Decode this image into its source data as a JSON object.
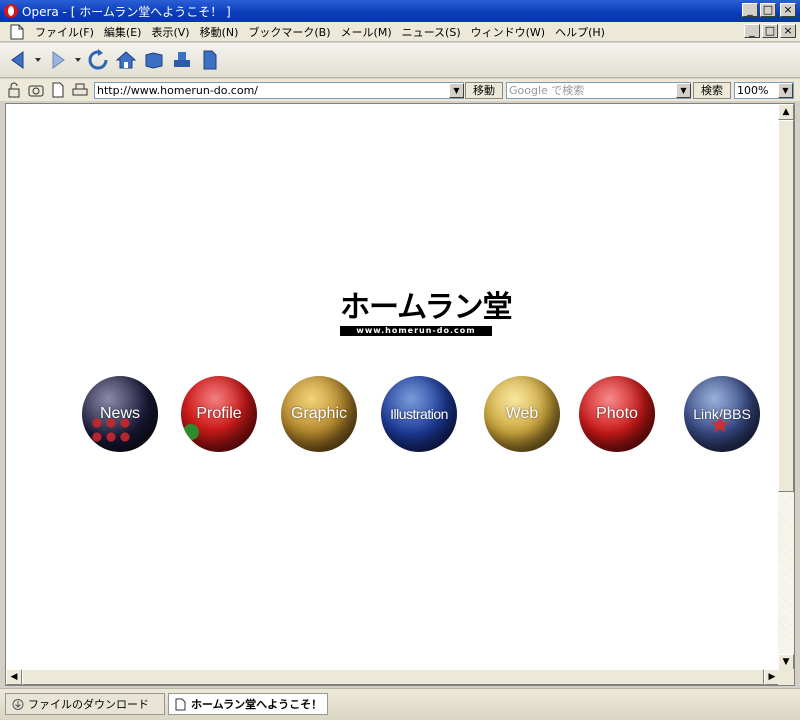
{
  "window": {
    "title": "Opera - [ ホームラン堂へようこそ！ ]",
    "controls": {
      "minimize": "_",
      "maximize": "□",
      "close": "×"
    }
  },
  "menu": {
    "items": [
      "ファイル(F)",
      "編集(E)",
      "表示(V)",
      "移動(N)",
      "ブックマーク(B)",
      "メール(M)",
      "ニュース(S)",
      "ウィンドウ(W)",
      "ヘルプ(H)"
    ]
  },
  "toolbar": {
    "icons": [
      "back-icon",
      "forward-icon",
      "reload-icon",
      "home-icon",
      "hotlist-icon",
      "print-icon",
      "page-icon"
    ]
  },
  "address": {
    "url": "http://www.homerun-do.com/",
    "go_label": "移動",
    "search_placeholder": "Google で検索",
    "search_label": "検索",
    "zoom": "100%"
  },
  "page": {
    "logo_main": "ホームラン堂",
    "logo_sub": "www.homerun-do.com",
    "nav": [
      "News",
      "Profile",
      "Graphic",
      "Illustration",
      "Web",
      "Photo",
      "Link/BBS"
    ]
  },
  "tabs": {
    "items": [
      "ファイルのダウンロード",
      "ホームラン堂へようこそ！"
    ],
    "active": 1
  },
  "colors": {
    "titlebar": "#0a3cb8",
    "chrome": "#ece9d8",
    "page_bg": "#ffffff"
  }
}
